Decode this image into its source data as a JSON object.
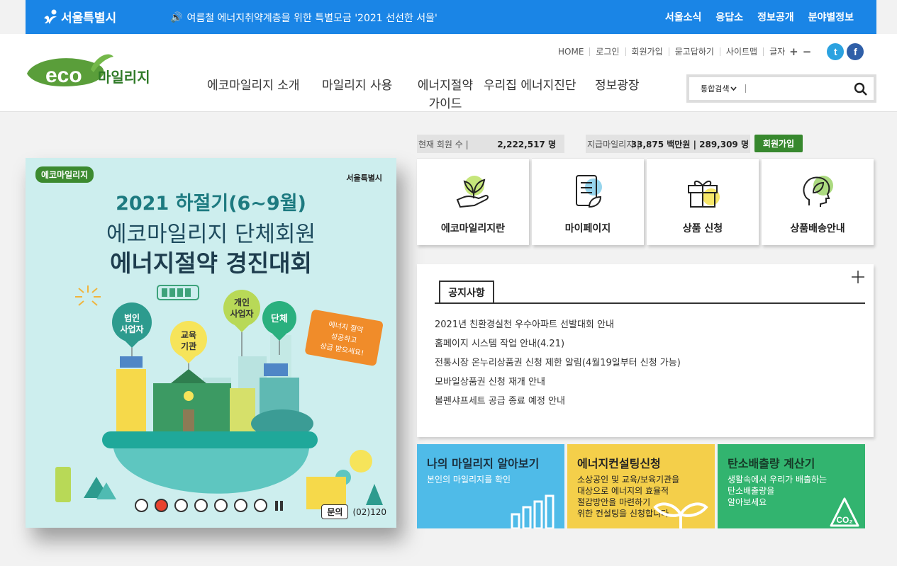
{
  "topbar": {
    "brand": "서울특별시",
    "notice": "여름철 에너지취약계층을 위한 특별모금 '2021 선선한 서울'",
    "nav": [
      "서울소식",
      "응답소",
      "정보공개",
      "분야별정보"
    ]
  },
  "header": {
    "utility": [
      "HOME",
      "로그인",
      "회원가입",
      "묻고답하기",
      "사이트맵"
    ],
    "font_size_label": "글자",
    "font_plus": "+",
    "font_minus": "−",
    "social": {
      "twitter": "t",
      "facebook": "f"
    },
    "gnb": [
      "에코마일리지 소개",
      "마일리지 사용",
      "에너지절약\n가이드",
      "우리집 에너지진단",
      "정보광장"
    ],
    "search": {
      "scope": "통합검색",
      "placeholder": ""
    }
  },
  "banner": {
    "eco_logo": "에코마일리지",
    "seoul_logo": "서울특별시",
    "title1": "2021 하절기(6~9월)",
    "title2": "에코마일리지 단체회원",
    "title3": "에너지절약 경진대회",
    "balloons": [
      "법인\n사업자",
      "교육\n기관",
      "개인\n사업자",
      "단체"
    ],
    "callout": "에너지 절약\n성공하고\n상금 받으세요!",
    "slide_count": 7,
    "active_slide": 2,
    "contact_label": "문의",
    "contact_number": "(02)120"
  },
  "stats": {
    "members_label": "현재 회원 수 |",
    "members_value": "2,222,517 명",
    "mileage_label": "지급마일리지 |",
    "mileage_value": "33,875 백만원 | 289,309 명",
    "join_button": "회원가입"
  },
  "quick_menu": [
    {
      "label": "에코마일리지란",
      "icon": "plant-hand-icon"
    },
    {
      "label": "마이페이지",
      "icon": "document-leaf-icon"
    },
    {
      "label": "상품 신청",
      "icon": "gift-icon"
    },
    {
      "label": "상품배송안내",
      "icon": "head-leaf-icon"
    }
  ],
  "notice": {
    "tab": "공지사항",
    "items": [
      "2021년 친환경실천 우수아파트 선발대회 안내",
      "홈페이지 시스템 작업 안내(4.21)",
      "전통시장 온누리상품권 신청 제한 알림(4월19일부터 신청 가능)",
      "모바일상품권 신청 재개 안내",
      "볼펜샤프세트 공급 종료 예정 안내"
    ]
  },
  "tiles": [
    {
      "title": "나의 마일리지 알아보기",
      "desc": "본인의 마일리지를 확인"
    },
    {
      "title": "에너지컨설팅신청",
      "desc": "소상공인 및 교육/보육기관을\n대상으로 에너지의 효율적\n절감방안을 마련하기\n위한 컨설팅을 신청합니다."
    },
    {
      "title": "탄소배출량 계산기",
      "desc": "생활속에서 우리가 배출하는\n탄소배출량을\n알아보세요"
    }
  ],
  "colors": {
    "topbar": "#1a85e6",
    "eco_green": "#37882e",
    "tile_blue": "#4fbbe8",
    "tile_yellow": "#f4cf4a",
    "tile_green": "#32b46f"
  }
}
